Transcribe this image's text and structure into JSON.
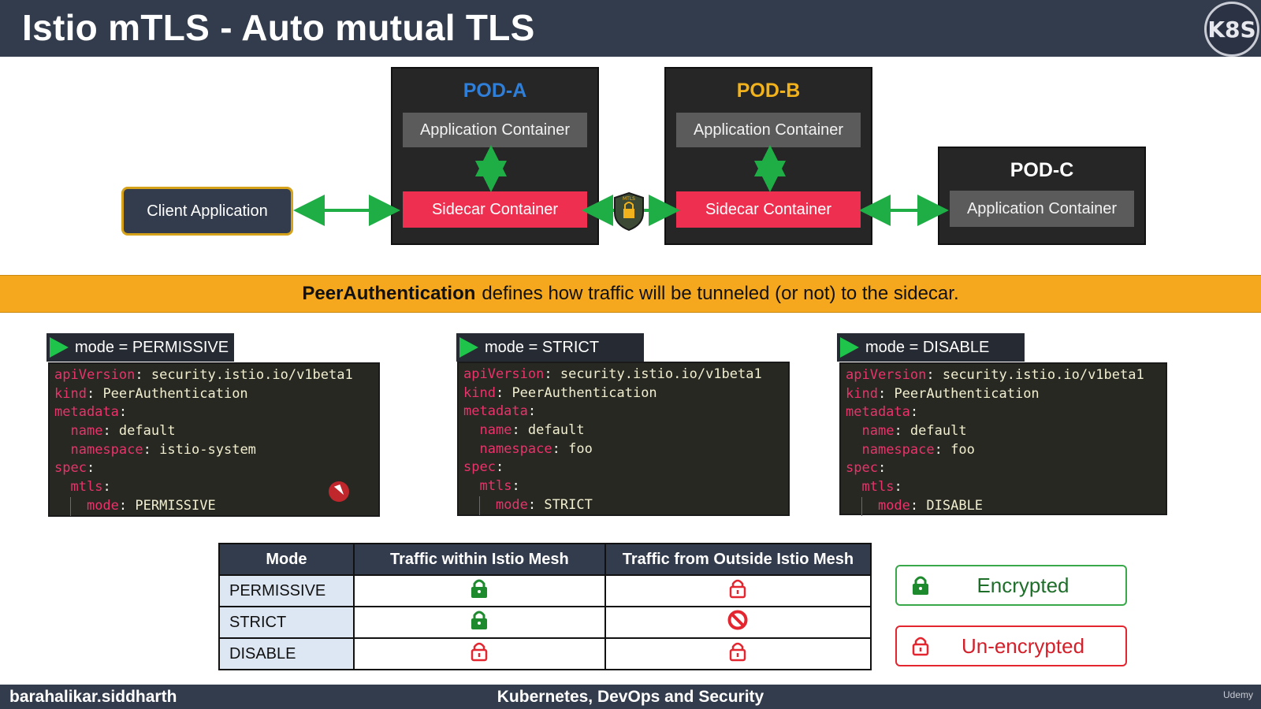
{
  "header": {
    "title": "Istio mTLS - Auto mutual TLS",
    "logo_text": "K8S"
  },
  "diagram": {
    "client": "Client Application",
    "pods": [
      {
        "name": "POD-A",
        "color": "#2f7ed8",
        "app": "Application Container",
        "sidecar": "Sidecar Container"
      },
      {
        "name": "POD-B",
        "color": "#f2b21b",
        "app": "Application Container",
        "sidecar": "Sidecar Container"
      },
      {
        "name": "POD-C",
        "color": "#ffffff",
        "app": "Application Container"
      }
    ],
    "mtls_badge": "MTLS"
  },
  "banner": {
    "bold": "PeerAuthentication",
    "rest": "defines how traffic will be tunneled (or not) to the sidecar."
  },
  "modes": [
    {
      "label": "mode = PERMISSIVE",
      "apiVersion": "security.istio.io/v1beta1",
      "kind": "PeerAuthentication",
      "name": "default",
      "namespace": "istio-system",
      "mode": "PERMISSIVE"
    },
    {
      "label": "mode = STRICT",
      "apiVersion": "security.istio.io/v1beta1",
      "kind": "PeerAuthentication",
      "name": "default",
      "namespace": "foo",
      "mode": "STRICT"
    },
    {
      "label": "mode = DISABLE",
      "apiVersion": "security.istio.io/v1beta1",
      "kind": "PeerAuthentication",
      "name": "default",
      "namespace": "foo",
      "mode": "DISABLE"
    }
  ],
  "code_keys": {
    "apiVersion": "apiVersion",
    "kind": "kind",
    "metadata": "metadata",
    "name": "name",
    "namespace": "namespace",
    "spec": "spec",
    "mtls": "mtls",
    "mode": "mode"
  },
  "table": {
    "headers": [
      "Mode",
      "Traffic within Istio Mesh",
      "Traffic from Outside Istio Mesh"
    ],
    "rows": [
      {
        "mode": "PERMISSIVE",
        "within": "locked-icon",
        "outside": "unlocked-icon"
      },
      {
        "mode": "STRICT",
        "within": "locked-icon",
        "outside": "blocked-icon"
      },
      {
        "mode": "DISABLE",
        "within": "unlocked-icon",
        "outside": "unlocked-icon"
      }
    ]
  },
  "legend": {
    "encrypted": "Encrypted",
    "unencrypted": "Un-encrypted"
  },
  "footer": {
    "left": "barahalikar.siddharth",
    "center": "Kubernetes, DevOps and Security",
    "right": "Udemy"
  },
  "colors": {
    "accent_green": "#1fc44a",
    "sidecar_red": "#ee2f4f",
    "banner_orange": "#f5a81d",
    "header_navy": "#333c4c"
  }
}
